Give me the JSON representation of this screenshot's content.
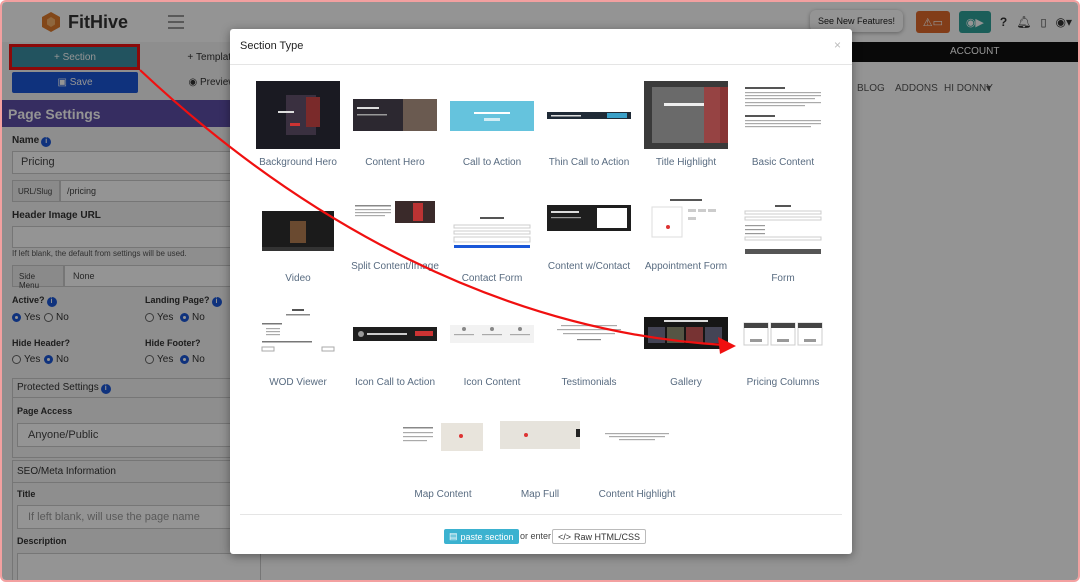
{
  "app": {
    "name": "FitHive"
  },
  "topbar": {
    "features_label": "See New Features!"
  },
  "sidebar": {
    "section_label": "Section",
    "template_label": "Template",
    "save_label": "Save",
    "preview_label": "Preview",
    "page_settings_title": "Page Settings",
    "name_label": "Name",
    "name_value": "Pricing",
    "url_slug_label": "URL/Slug",
    "url_slug_value": "/pricing",
    "header_image_label": "Header Image URL",
    "header_image_hint": "If left blank, the default from settings will be used.",
    "side_menu_label": "Side Menu",
    "side_menu_value": "None",
    "active_label": "Active?",
    "landing_label": "Landing Page?",
    "hide_header_label": "Hide Header?",
    "hide_footer_label": "Hide Footer?",
    "yes": "Yes",
    "no": "No",
    "protected_settings_label": "Protected Settings",
    "page_access_label": "Page Access",
    "page_access_value": "Anyone/Public",
    "seo_label": "SEO/Meta Information",
    "title_label": "Title",
    "title_placeholder": "If left blank, will use the page name",
    "description_label": "Description"
  },
  "background": {
    "account_label": "ACCOUNT",
    "nav": [
      "BLOG",
      "ADDONS",
      "HI DONNY"
    ]
  },
  "modal": {
    "title": "Section Type",
    "close": "×",
    "sections": [
      "Background Hero",
      "Content Hero",
      "Call to Action",
      "Thin Call to Action",
      "Title Highlight",
      "Basic Content",
      "Video",
      "Split Content/Image",
      "Contact Form",
      "Content w/Contact",
      "Appointment Form",
      "Form",
      "WOD Viewer",
      "Icon Call to Action",
      "Icon Content",
      "Testimonials",
      "Gallery",
      "Pricing Columns",
      "Map Content",
      "Map Full",
      "Content Highlight"
    ],
    "paste_label": "paste section",
    "or_enter": "or enter",
    "raw_label": "Raw HTML/CSS"
  },
  "colors": {
    "accent": "#3b8fa4",
    "save": "#1a57d8",
    "header": "#5d4fa8",
    "annotation": "#f01010"
  }
}
